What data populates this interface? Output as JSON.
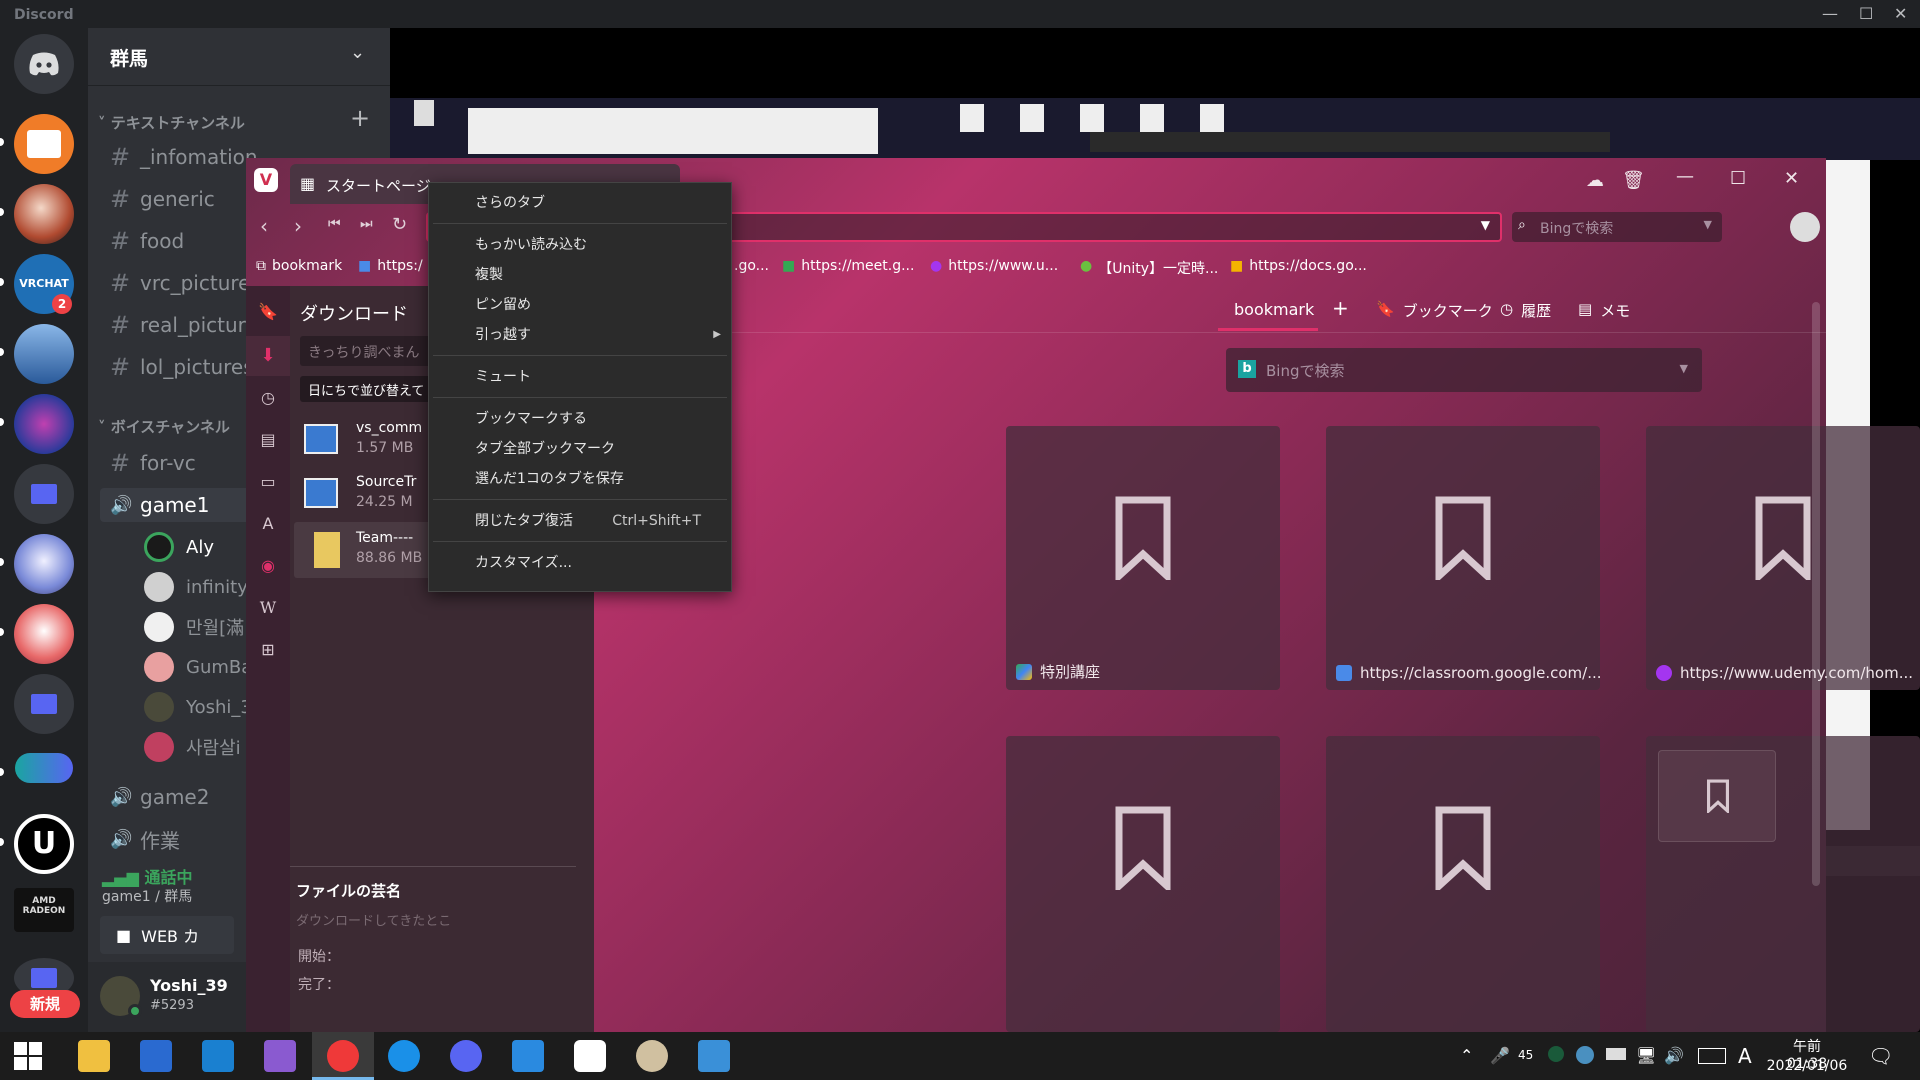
{
  "discord": {
    "app_title": "Discord",
    "server_name": "群馬",
    "text_category": "テキストチャンネル",
    "text_channels": [
      "_infomation_",
      "generic",
      "food",
      "vrc_picture",
      "real_picture",
      "lol_pictures"
    ],
    "voice_category": "ボイスチャンネル",
    "voice_channels": [
      "for-vc",
      "game1",
      "game2",
      "作業"
    ],
    "voice_users": [
      "Aly",
      "infinity",
      "만월[滿",
      "GumBas",
      "Yoshi_3",
      "사람살i"
    ],
    "call_status": "通話中",
    "call_location": "game1 / 群馬",
    "web_button": "WEB カ",
    "username": "Yoshi_39",
    "discriminator": "#5293",
    "new_badge": "新規",
    "guild_badge": "2",
    "guild_label_vrchat": "VRCHAT",
    "guild_label_amd": "AMD RADEON"
  },
  "vivaldi": {
    "tab_title": "スタートページ",
    "search_placeholder": "Bingで検索",
    "bookmarks_bar": [
      "bookmark",
      "https:/",
      ".go...",
      "https://meet.g...",
      "https://www.u...",
      "【Unity】一定時...",
      "https://docs.go..."
    ],
    "panel_title": "ダウンロード",
    "panel_search_placeholder": "きっちり調べまん",
    "panel_sort": "日にちで並び替えて",
    "downloads": [
      {
        "name": "vs_comm",
        "size": "1.57 MB"
      },
      {
        "name": "SourceTr",
        "size": "24.25 M"
      },
      {
        "name": "Team----",
        "size": "88.86 MB"
      }
    ],
    "details_title": "ファイルの芸名",
    "details_sub": "ダウンロードしてきたとこ",
    "details_start": "開始：",
    "details_end": "完了：",
    "speed_dial_tabs": [
      "bookmark",
      "ブックマーク",
      "履歴",
      "メモ"
    ],
    "main_search_placeholder": "Bingで検索",
    "tiles": [
      "特別講座",
      "https://classroom.google.com/...",
      "https://www.udemy.com/hom..."
    ]
  },
  "context_menu": {
    "items": [
      {
        "label": "さらのタブ",
        "shortcut": ""
      },
      {
        "label": "もっかい読み込む",
        "shortcut": ""
      },
      {
        "label": "複製",
        "shortcut": ""
      },
      {
        "label": "ピン留め",
        "shortcut": ""
      },
      {
        "label": "引っ越す",
        "shortcut": ""
      },
      {
        "label": "ミュート",
        "shortcut": ""
      },
      {
        "label": "ブックマークする",
        "shortcut": ""
      },
      {
        "label": "タブ全部ブックマーク",
        "shortcut": ""
      },
      {
        "label": "選んだ1コのタブを保存",
        "shortcut": ""
      },
      {
        "label": "閉じたタブ復活",
        "shortcut": "Ctrl+Shift+T"
      },
      {
        "label": "カスタマイズ...",
        "shortcut": ""
      }
    ]
  },
  "taskbar": {
    "time": "午前 01:38",
    "date": "2022/01/06",
    "volume_level": "45",
    "ime": "A",
    "app_icons": [
      "windows-start",
      "file-explorer",
      "store",
      "mail",
      "visual-studio",
      "vivaldi",
      "firefox",
      "discord",
      "app",
      "oculus",
      "paint",
      "photos"
    ]
  },
  "colors": {
    "discord_bg": "#202225",
    "channel_bg": "#2f3136",
    "accent_green": "#3ba55d",
    "vivaldi_pink": "#b8336a"
  }
}
